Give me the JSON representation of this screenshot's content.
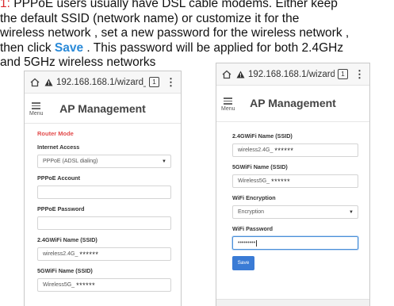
{
  "instructions": {
    "number": "1:",
    "line1_rest": " PPPoE users usually have DSL cable modems. Either keep",
    "line2": "the default SSID (network name) or customize it for the",
    "line3": "wireless network , set a new password  for the wireless network ,",
    "line4_before": "then click ",
    "save_word": "Save",
    "line4_after": " .  This password will be applied for both 2.4GHz",
    "line5": "and 5GHz wireless networks"
  },
  "browser": {
    "url_left": "192.168.168.1/wizard_",
    "url_right": "192.168.168.1/wizard_",
    "tab_count": "1"
  },
  "app": {
    "title": "AP Management",
    "menu_label": "Menu"
  },
  "left_form": {
    "section_title": "Router Mode",
    "internet_access_label": "Internet Access",
    "internet_access_value": "PPPoE (ADSL dialing)",
    "pppoe_account_label": "PPPoE Account",
    "pppoe_password_label": "PPPoE Password",
    "ssid24_label": "2.4GWiFi Name (SSID)",
    "ssid24_prefix": "wireless2.4G_",
    "ssid24_mask": "******",
    "ssid5_label": "5GWiFi Name (SSID)",
    "ssid5_prefix": "Wireless5G_",
    "ssid5_mask": "******"
  },
  "right_form": {
    "ssid24_label": "2.4GWiFi Name (SSID)",
    "ssid24_prefix": "wireless2.4G_",
    "ssid24_mask": "******",
    "ssid5_label": "5GWiFi Name (SSID)",
    "ssid5_prefix": "Wireless5G_",
    "ssid5_mask": "******",
    "encryption_label": "WiFi Encryption",
    "encryption_value": "Encryption",
    "password_label": "WiFi Password",
    "password_value": "•••••••••",
    "save_label": "Save"
  },
  "colors": {
    "accent": "#3a7bd5",
    "step_number": "#d9262b",
    "save_highlight": "#2a8ad8",
    "section_title": "#e24b4b"
  },
  "icons": [
    "home-icon",
    "warning-icon",
    "tabs-icon",
    "more-icon",
    "menu-icon",
    "chevron-down-icon"
  ]
}
